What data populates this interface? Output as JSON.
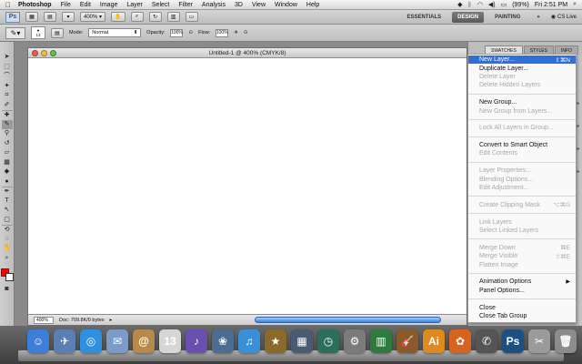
{
  "menubar": {
    "app_name": "Photoshop",
    "items": [
      "File",
      "Edit",
      "Image",
      "Layer",
      "Select",
      "Filter",
      "Analysis",
      "3D",
      "View",
      "Window",
      "Help"
    ],
    "battery": "(99%)",
    "clock": "Fri 2:51 PM"
  },
  "appbar": {
    "logo": "Ps",
    "zoom": "400%",
    "workspaces": [
      "ESSENTIALS",
      "DESIGN",
      "PAINTING"
    ],
    "active_workspace": "DESIGN",
    "cs_live": "CS Live"
  },
  "options": {
    "brush_size": "13",
    "mode_label": "Mode:",
    "mode_value": "Normal",
    "opacity_label": "Opacity:",
    "opacity_value": "100%",
    "flow_label": "Flow:",
    "flow_value": "100%"
  },
  "tools": [
    "▭",
    "⬚",
    "⌒",
    "✦",
    "⌗",
    "✎",
    "⌶",
    "✐",
    "▤",
    "◐",
    "⬤",
    "◼",
    "♦",
    "✒",
    "T",
    "↖",
    "▢",
    "✋",
    "🔍"
  ],
  "document": {
    "title": "Untitled-1 @ 400% (CMYK/8)",
    "zoom": "400%",
    "status": "Doc: 709.8K/0 bytes"
  },
  "panel": {
    "tabs": [
      "SWATCHES",
      "STYLES",
      "INFO"
    ]
  },
  "flyout": {
    "items": [
      {
        "label": "New Layer...",
        "shortcut": "⇧⌘N",
        "state": "highlighted"
      },
      {
        "label": "Duplicate Layer...",
        "state": "enabled"
      },
      {
        "label": "Delete Layer",
        "state": "disabled"
      },
      {
        "label": "Delete Hidden Layers",
        "state": "disabled"
      },
      {
        "sep": true
      },
      {
        "label": "New Group...",
        "state": "enabled"
      },
      {
        "label": "New Group from Layers...",
        "state": "disabled"
      },
      {
        "sep": true
      },
      {
        "label": "Lock All Layers in Group...",
        "state": "disabled"
      },
      {
        "sep": true
      },
      {
        "label": "Convert to Smart Object",
        "state": "enabled"
      },
      {
        "label": "Edit Contents",
        "state": "disabled"
      },
      {
        "sep": true
      },
      {
        "label": "Layer Properties...",
        "state": "disabled"
      },
      {
        "label": "Blending Options...",
        "state": "disabled"
      },
      {
        "label": "Edit Adjustment...",
        "state": "disabled"
      },
      {
        "sep": true
      },
      {
        "label": "Create Clipping Mask",
        "shortcut": "⌥⌘G",
        "state": "disabled"
      },
      {
        "sep": true
      },
      {
        "label": "Link Layers",
        "state": "disabled"
      },
      {
        "label": "Select Linked Layers",
        "state": "disabled"
      },
      {
        "sep": true
      },
      {
        "label": "Merge Down",
        "shortcut": "⌘E",
        "state": "disabled"
      },
      {
        "label": "Merge Visible",
        "shortcut": "⇧⌘E",
        "state": "disabled"
      },
      {
        "label": "Flatten Image",
        "state": "disabled"
      },
      {
        "sep": true
      },
      {
        "label": "Animation Options",
        "submenu": "▶",
        "state": "enabled"
      },
      {
        "label": "Panel Options...",
        "state": "enabled"
      },
      {
        "sep": true
      },
      {
        "label": "Close",
        "state": "enabled"
      },
      {
        "label": "Close Tab Group",
        "state": "enabled"
      }
    ]
  },
  "dock": {
    "apps": [
      {
        "name": "finder-icon",
        "glyph": "☺",
        "color": "#3c7ed8"
      },
      {
        "name": "preview-icon",
        "glyph": "✈",
        "color": "#5a7fb5"
      },
      {
        "name": "safari-icon",
        "glyph": "◎",
        "color": "#2f8fe0"
      },
      {
        "name": "mail-icon",
        "glyph": "✉",
        "color": "#7a9cc6"
      },
      {
        "name": "addressbook-icon",
        "glyph": "@",
        "color": "#b88a4a"
      },
      {
        "name": "ical-icon",
        "glyph": "13",
        "color": "#d6d6d6"
      },
      {
        "name": "guitar-icon",
        "glyph": "♪",
        "color": "#6b4fb0"
      },
      {
        "name": "iphoto-icon",
        "glyph": "❀",
        "color": "#4c6d92"
      },
      {
        "name": "itunes-icon",
        "glyph": "♫",
        "color": "#3b8ed8"
      },
      {
        "name": "imovie-icon",
        "glyph": "★",
        "color": "#8a6a2a"
      },
      {
        "name": "spaces-icon",
        "glyph": "▦",
        "color": "#4a5a72"
      },
      {
        "name": "timemachine-icon",
        "glyph": "◷",
        "color": "#2c6e5c"
      },
      {
        "name": "systemprefs-icon",
        "glyph": "⚙",
        "color": "#7b7b7b"
      },
      {
        "name": "activity-icon",
        "glyph": "▥",
        "color": "#2f7a3d"
      },
      {
        "name": "guitar2-icon",
        "glyph": "🎸",
        "color": "#8a5a2a"
      },
      {
        "name": "illustrator-icon",
        "glyph": "Ai",
        "color": "#e08a1e"
      },
      {
        "name": "firefox-icon",
        "glyph": "✿",
        "color": "#d8631e"
      },
      {
        "name": "mail2-icon",
        "glyph": "✆",
        "color": "#555555"
      },
      {
        "name": "photoshop-icon",
        "glyph": "Ps",
        "color": "#1d4f82"
      },
      {
        "name": "tools-icon",
        "glyph": "✂",
        "color": "#9a9a9a"
      },
      {
        "name": "trash-icon",
        "glyph": "🗑",
        "color": "#8c8c8c"
      }
    ]
  }
}
